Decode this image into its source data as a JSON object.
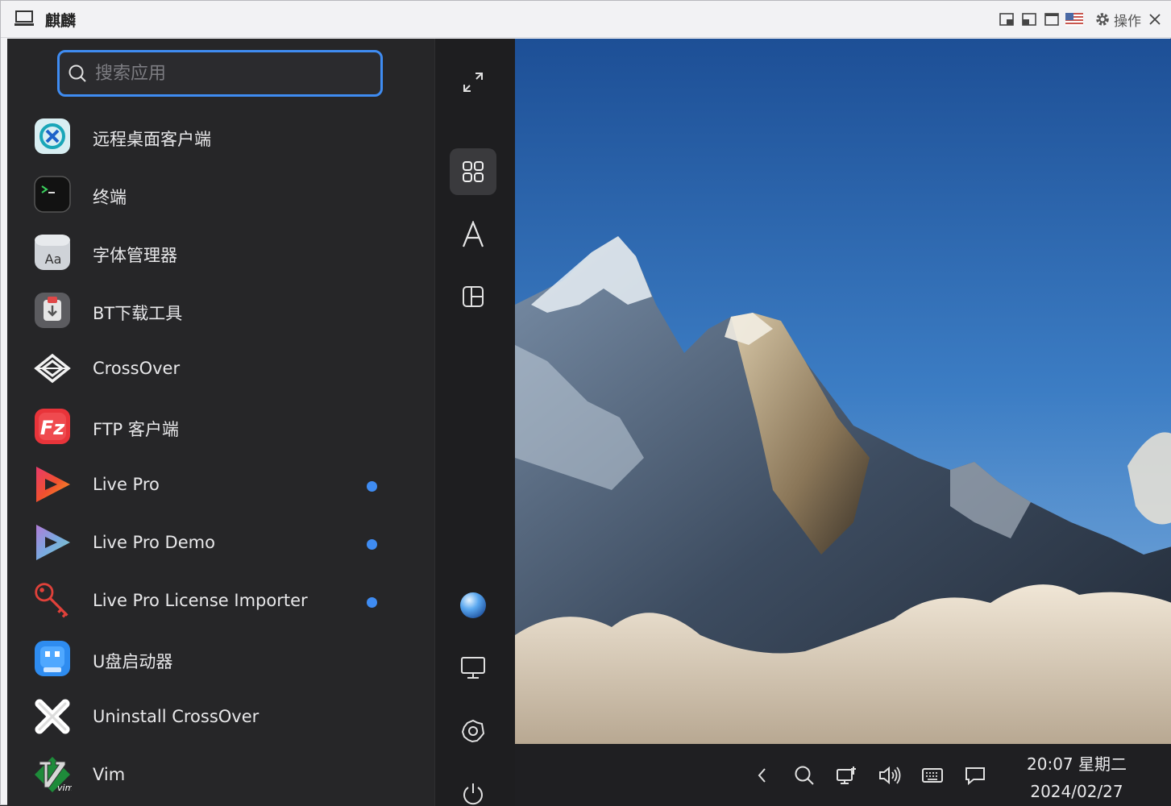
{
  "window": {
    "title": "麒麟",
    "ops_label": "操作"
  },
  "search": {
    "placeholder": "搜索应用"
  },
  "apps": [
    {
      "label": "远程桌面客户端",
      "icon": "remote-desktop-icon",
      "new": false
    },
    {
      "label": "终端",
      "icon": "terminal-icon",
      "new": false
    },
    {
      "label": "字体管理器",
      "icon": "font-manager-icon",
      "new": false
    },
    {
      "label": "BT下载工具",
      "icon": "bt-download-icon",
      "new": false
    },
    {
      "label": "CrossOver",
      "icon": "crossover-icon",
      "new": false
    },
    {
      "label": "FTP 客户端",
      "icon": "filezilla-icon",
      "new": false
    },
    {
      "label": "Live Pro",
      "icon": "live-pro-icon",
      "new": true
    },
    {
      "label": "Live Pro Demo",
      "icon": "live-pro-demo-icon",
      "new": true
    },
    {
      "label": "Live Pro License Importer",
      "icon": "key-icon",
      "new": true
    },
    {
      "label": "U盘启动器",
      "icon": "usb-starter-icon",
      "new": false
    },
    {
      "label": "Uninstall CrossOver",
      "icon": "uninstall-x-icon",
      "new": false
    },
    {
      "label": "Vim",
      "icon": "vim-icon",
      "new": false
    }
  ],
  "sidebar": {
    "buttons": [
      "expand-icon",
      "all-apps-grid-icon",
      "alphabetical-icon",
      "category-icon",
      "user-avatar-icon",
      "computer-icon",
      "settings-icon",
      "power-icon"
    ]
  },
  "taskbar": {
    "time": "20:07 星期二",
    "date": "2024/02/27",
    "tray": [
      "chevron-left-icon",
      "search-icon",
      "network-icon",
      "volume-icon",
      "keyboard-icon",
      "notification-icon"
    ]
  },
  "colors": {
    "accent": "#3f8cf2",
    "menu_bg": "#262628",
    "sidebar_bg": "#1e1e20",
    "taskbar_bg": "#1f1f22"
  }
}
